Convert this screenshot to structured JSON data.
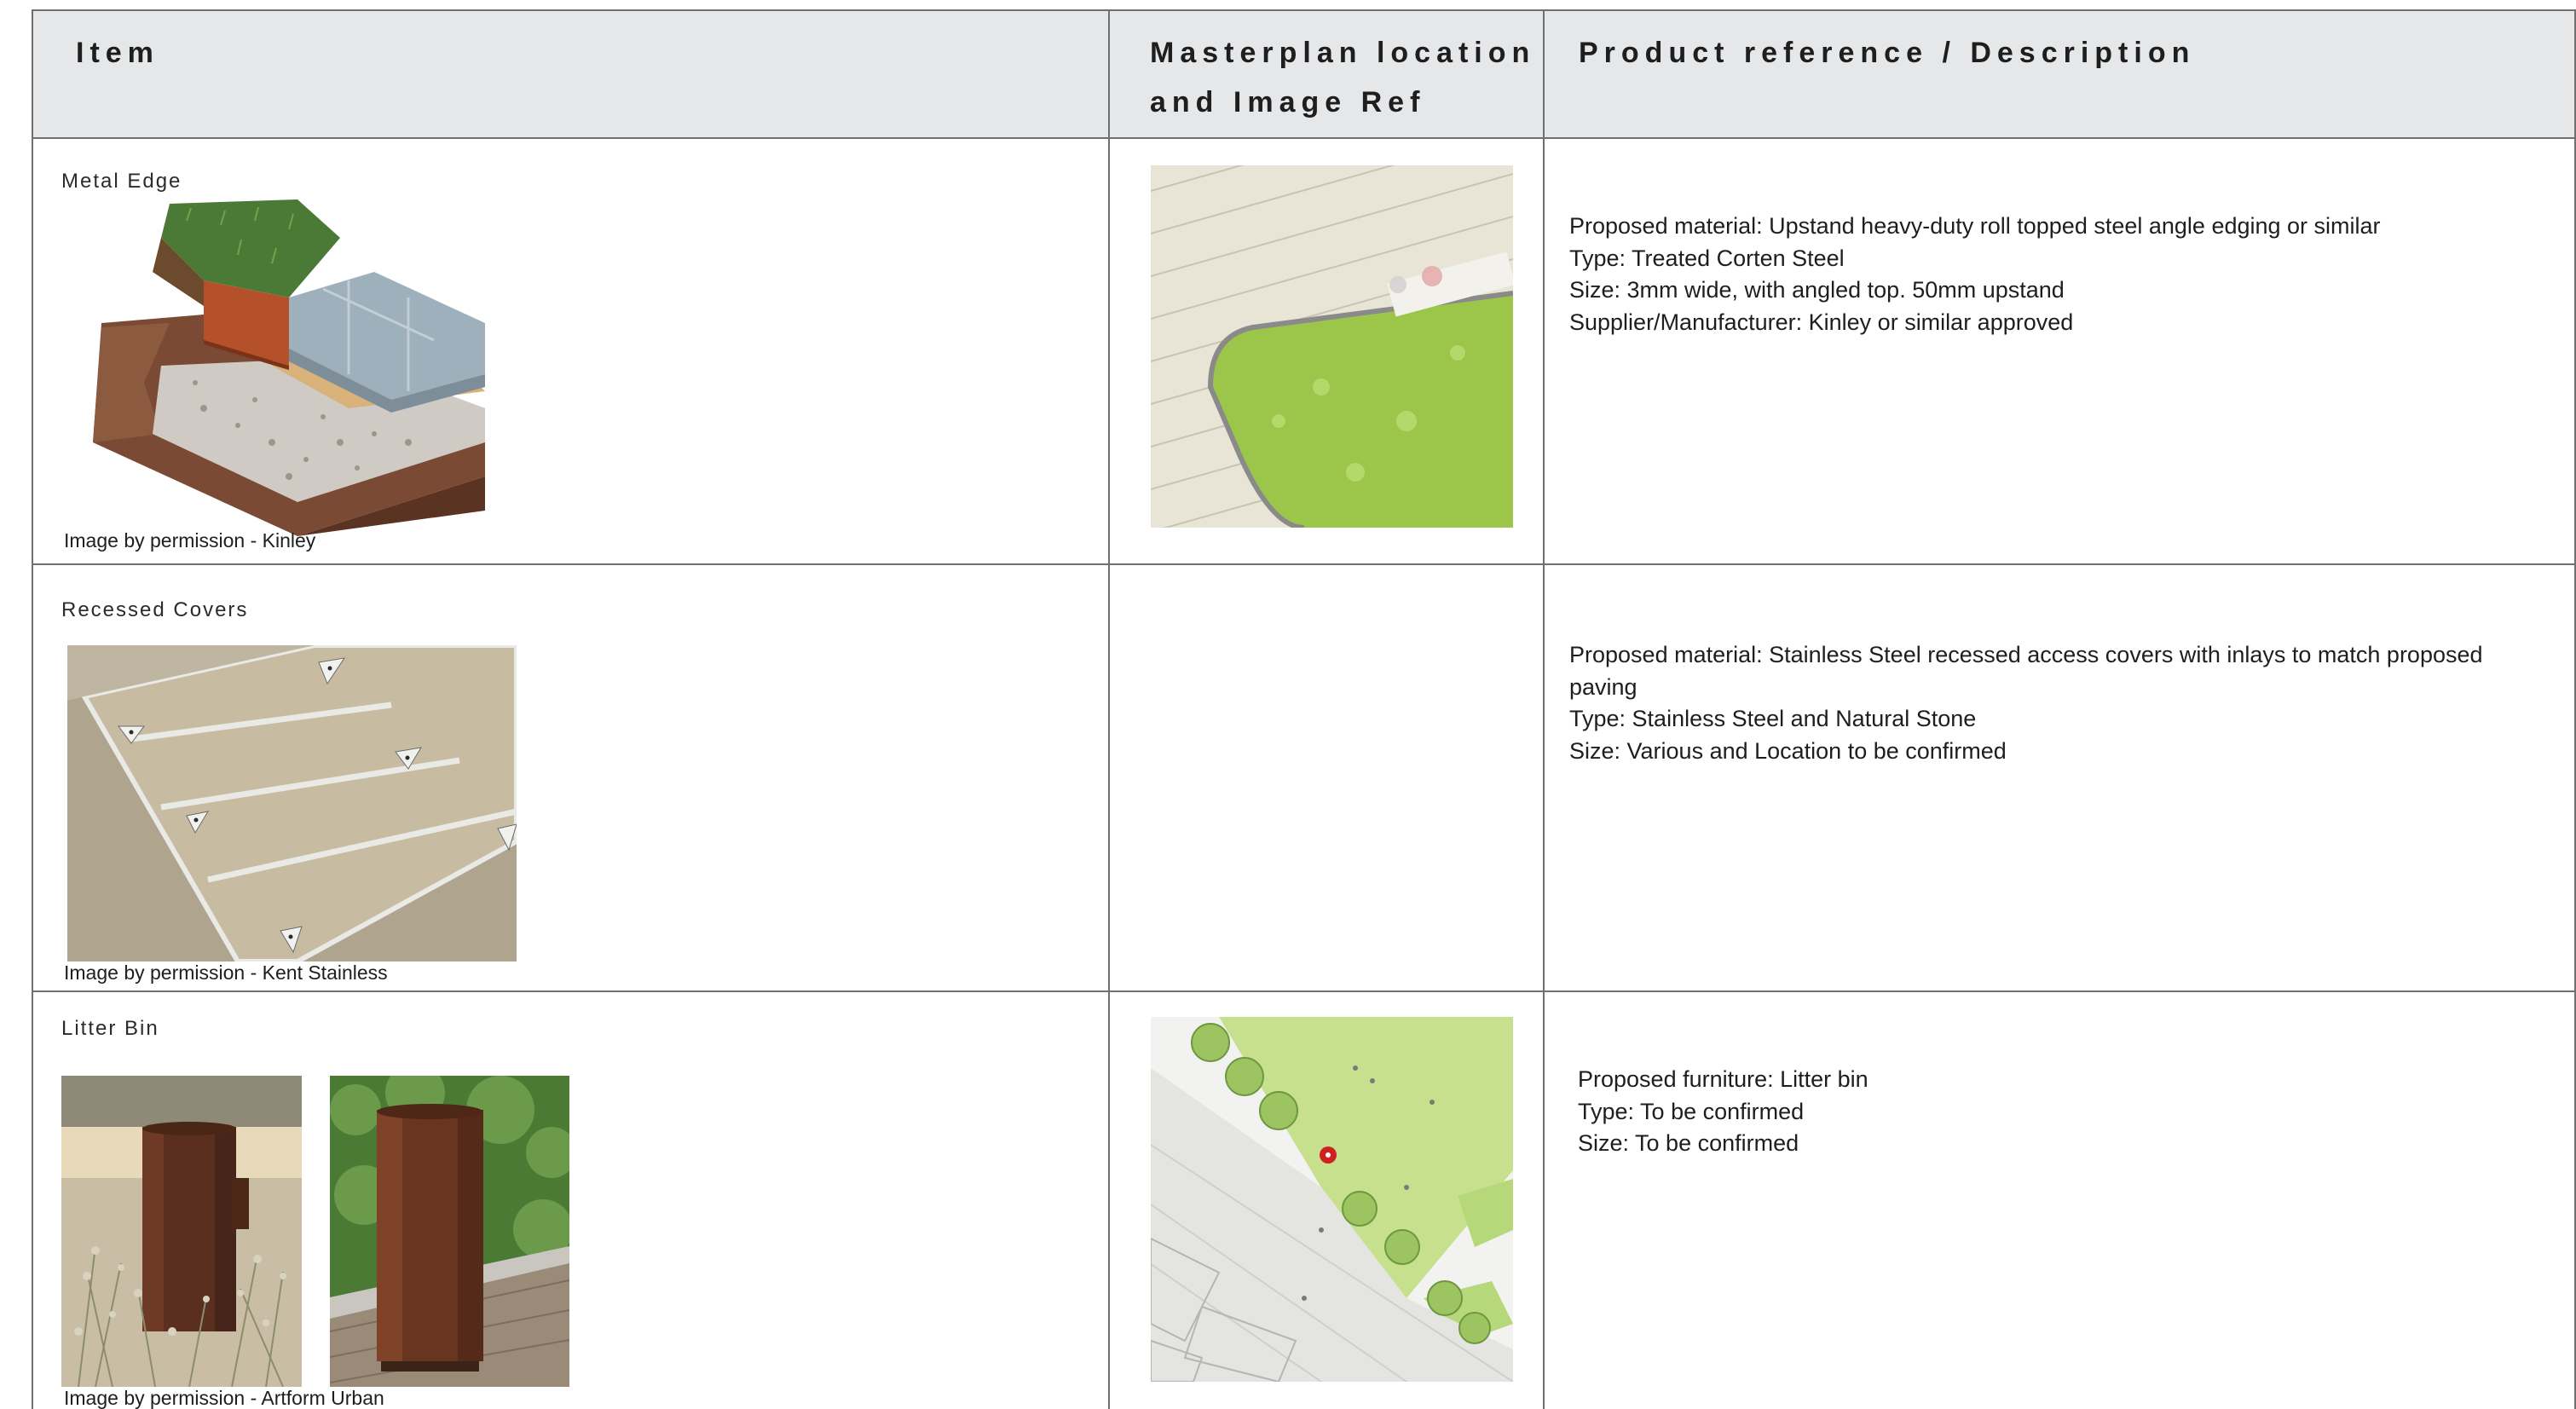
{
  "header": {
    "col_item": "Item",
    "col_location_line1": "Masterplan location",
    "col_location_line2": "and Image Ref",
    "col_product": "Product reference / Description"
  },
  "rows": [
    {
      "item": "Metal Edge",
      "credit": "Image by permission - Kinley",
      "description": [
        "Proposed material: Upstand heavy-duty roll topped steel angle edging or similar",
        "Type: Treated Corten Steel",
        "Size: 3mm wide, with angled top. 50mm upstand",
        "Supplier/Manufacturer: Kinley or similar approved"
      ]
    },
    {
      "item": "Recessed Covers",
      "credit": "Image by permission - Kent Stainless",
      "description": [
        "Proposed material: Stainless Steel recessed access covers with inlays to match proposed",
        "paving",
        "Type: Stainless Steel and Natural Stone",
        "Size: Various and Location to be confirmed"
      ]
    },
    {
      "item": "Litter Bin",
      "credit": "Image by permission - Artform Urban",
      "description": [
        "Proposed furniture: Litter bin",
        "Type: To be confirmed",
        "Size: To be confirmed"
      ]
    }
  ],
  "colors": {
    "header_bg": "#e6e7e9",
    "grid_line": "#6f6f6f",
    "corten": "#6b3a22",
    "grass": "#9bc64a",
    "marker_red": "#d02020"
  }
}
